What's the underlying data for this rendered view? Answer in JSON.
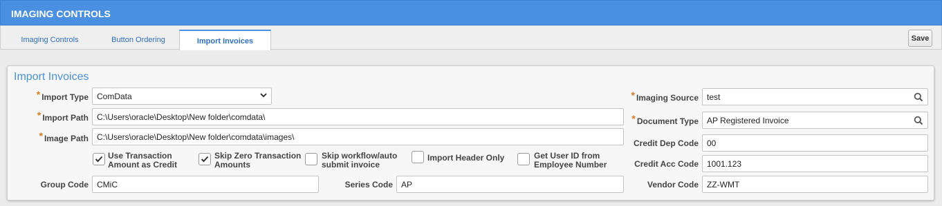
{
  "title": "IMAGING CONTROLS",
  "tabs": [
    {
      "label": "Imaging Controls"
    },
    {
      "label": "Button Ordering"
    },
    {
      "label": "Import Invoices"
    }
  ],
  "toolbar": {
    "save_label": "Save"
  },
  "section": {
    "title": "Import Invoices"
  },
  "required_marker": "*",
  "fields": {
    "import_type": {
      "label": "Import Type",
      "value": "ComData"
    },
    "import_path": {
      "label": "Import Path",
      "value": "C:\\Users\\oracle\\Desktop\\New folder\\comdata\\"
    },
    "image_path": {
      "label": "Image Path",
      "value": "C:\\Users\\oracle\\Desktop\\New folder\\comdata\\images\\"
    },
    "group_code": {
      "label": "Group Code",
      "value": "CMiC"
    },
    "series_code": {
      "label": "Series Code",
      "value": "AP"
    },
    "imaging_source": {
      "label": "Imaging Source",
      "value": "test"
    },
    "document_type": {
      "label": "Document Type",
      "value": "AP Registered Invoice"
    },
    "credit_dep_code": {
      "label": "Credit Dep Code",
      "value": "00"
    },
    "credit_acc_code": {
      "label": "Credit Acc Code",
      "value": "1001.123"
    },
    "vendor_code": {
      "label": "Vendor Code",
      "value": "ZZ-WMT"
    }
  },
  "checkboxes": [
    {
      "line1": "Use Transaction",
      "line2": "Amount as Credit",
      "checked": true
    },
    {
      "line1": "Skip Zero Transaction",
      "line2": "Amounts",
      "checked": true
    },
    {
      "line1": "Skip workflow/auto",
      "line2": "submit invoice",
      "checked": false
    },
    {
      "line1": "Import Header Only",
      "line2": "",
      "checked": false
    },
    {
      "line1": "Get User ID from",
      "line2": "Employee Number",
      "checked": false
    }
  ],
  "colors": {
    "accent": "#4a90e2",
    "required": "#e07a1f",
    "link": "#2f6fc4"
  }
}
